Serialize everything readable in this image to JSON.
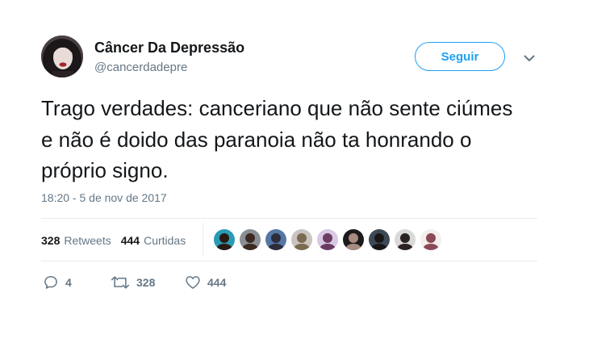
{
  "author": {
    "display_name": "Câncer Da Depressão",
    "handle": "@cancerdadepre",
    "avatar_icon": "profile-photo"
  },
  "follow_button": {
    "label": "Seguir"
  },
  "menu_icon": "chevron-down-icon",
  "tweet": {
    "text": "Trago verdades: canceriano que não sente ciúmes e não é doido das paranoia não ta honrando o próprio signo.",
    "timestamp": "18:20 - 5 de nov de 2017"
  },
  "stats": {
    "retweets_count": "328",
    "retweets_label": "Retweets",
    "likes_count": "444",
    "likes_label": "Curtidas"
  },
  "likers": [
    {
      "bg": "#2a9bb5",
      "fg": "#2b1a14"
    },
    {
      "bg": "#8a8f95",
      "fg": "#3c2a22"
    },
    {
      "bg": "#5577a6",
      "fg": "#2c2c3a"
    },
    {
      "bg": "#c9c4bf",
      "fg": "#7a6a50"
    },
    {
      "bg": "#d8c9e4",
      "fg": "#6c3b63"
    },
    {
      "bg": "#1c1a1b",
      "fg": "#a78b80"
    },
    {
      "bg": "#3d4a55",
      "fg": "#1a1618"
    },
    {
      "bg": "#d9d9d9",
      "fg": "#2a2322"
    },
    {
      "bg": "#f4eeee",
      "fg": "#8c4a55"
    }
  ],
  "actions": {
    "reply_count": "4",
    "retweet_count": "328",
    "like_count": "444"
  },
  "colors": {
    "accent": "#1da1f2",
    "text": "#14171a",
    "secondary": "#657786",
    "divider": "#e6ecf0"
  }
}
